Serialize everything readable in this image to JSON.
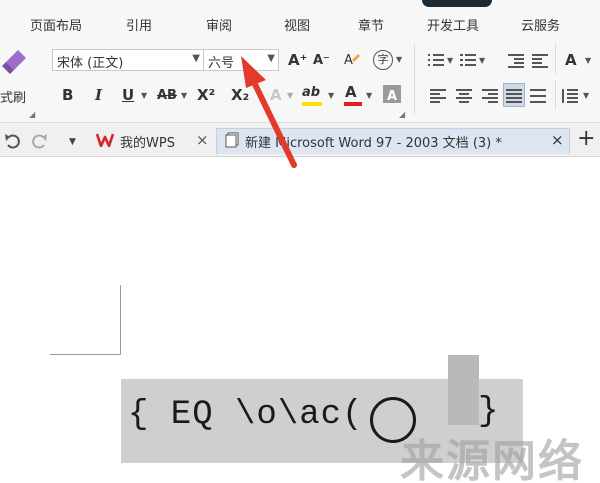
{
  "menu": {
    "items": [
      "页面布局",
      "引用",
      "审阅",
      "视图",
      "章节",
      "开发工具",
      "云服务"
    ]
  },
  "ribbon": {
    "format_painter_label": "式刷",
    "font_name": "宋体 (正文)",
    "font_size": "六号",
    "grow_font": "A⁺",
    "shrink_font": "A⁻",
    "bold": "B",
    "italic": "I",
    "underline": "U",
    "strikethrough": "AB",
    "superscript": "X²",
    "subscript": "X₂",
    "text_effect": "A",
    "highlight": "ab",
    "font_color": "A",
    "char_shading": "A",
    "phonetic": "字",
    "style_a": "A"
  },
  "tabs": {
    "wps_home": "我的WPS",
    "document": "新建 Microsoft Word 97 - 2003 文档 (3) *",
    "close_glyph": "×",
    "new_tab_glyph": "+"
  },
  "document": {
    "field_code": "{ EQ \\o\\ac(",
    "field_code_end": "}",
    "watermark": "来源网络"
  },
  "colors": {
    "wps_red": "#d7262b",
    "annotation_red": "#e23b2e",
    "font_color_bar": "#e02020",
    "highlight_bar": "#ffe000",
    "active_tab": "#dde5f0",
    "eq_highlight": "#cfcfcf"
  },
  "icons": {
    "format_painter": "brush-icon",
    "undo": "undo-icon",
    "redo": "redo-icon",
    "dropdown": "chevron-down-icon",
    "doc": "document-icon",
    "wps": "wps-logo-icon"
  }
}
